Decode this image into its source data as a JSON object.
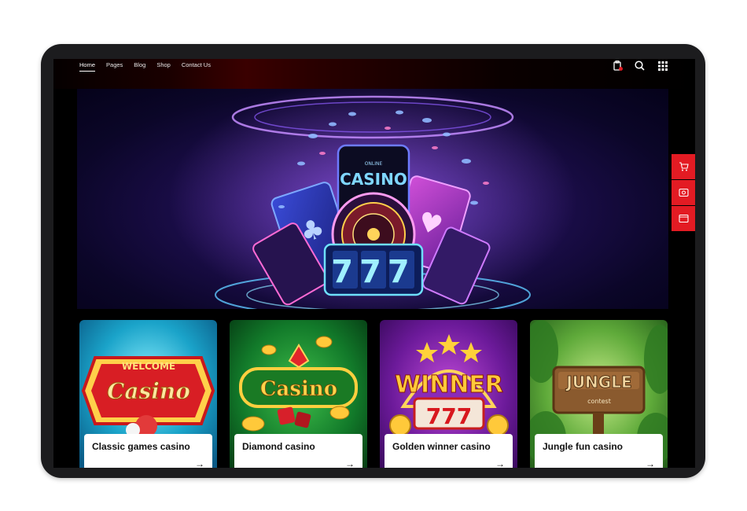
{
  "nav": {
    "items": [
      {
        "label": "Home",
        "active": true
      },
      {
        "label": "Pages"
      },
      {
        "label": "Blog"
      },
      {
        "label": "Shop"
      },
      {
        "label": "Contact Us"
      }
    ],
    "icons": [
      "cart-badge-icon",
      "search-icon",
      "grid-menu-icon"
    ]
  },
  "hero": {
    "phone_text_top": "ONLINE",
    "phone_text": "CASINO",
    "slot_text": "777"
  },
  "side_tools": [
    "cart-icon",
    "photo-icon",
    "window-icon"
  ],
  "cards": [
    {
      "title": "Classic games casino",
      "sign_top": "WELCOME",
      "sign_main": "Casino",
      "arrow": "→"
    },
    {
      "title": "Diamond casino",
      "sign_main": "Casino",
      "arrow": "→"
    },
    {
      "title": "Golden winner casino",
      "sign_main": "WINNER",
      "sign_sub": "777",
      "arrow": "→"
    },
    {
      "title": "Jungle fun casino",
      "sign_main": "JUNGLE",
      "sign_sub": "contest",
      "arrow": "→"
    }
  ],
  "colors": {
    "accent": "#e31b23",
    "hero_bg": "#1d0e4e"
  }
}
